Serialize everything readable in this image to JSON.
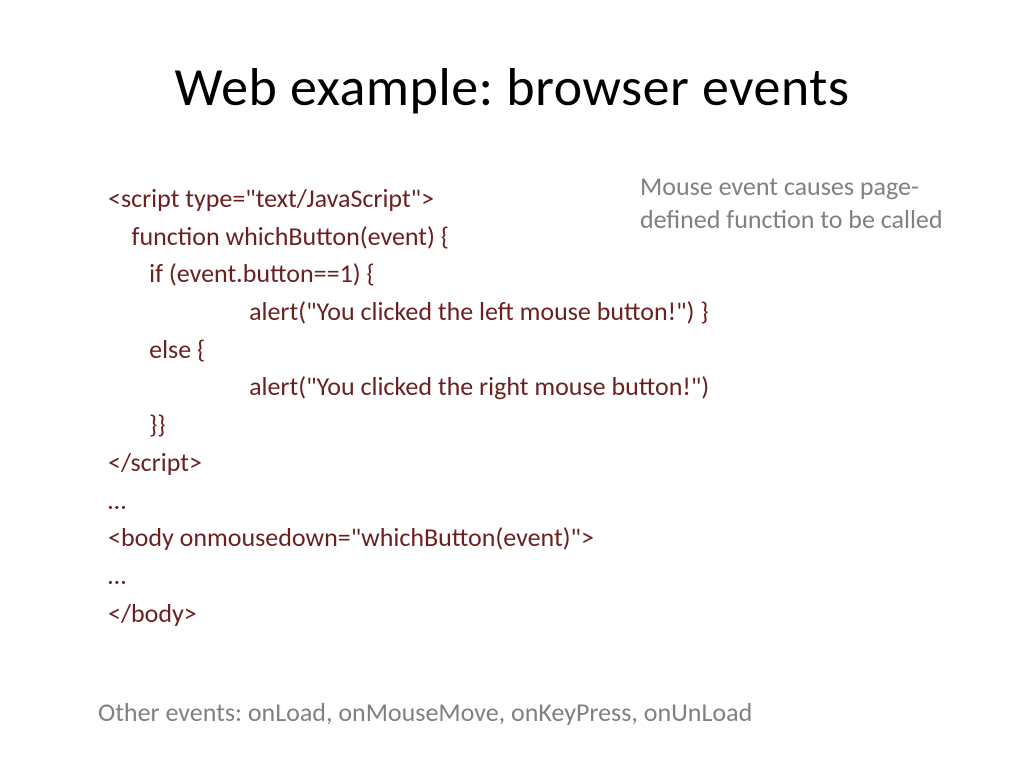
{
  "title": "Web example: browser events",
  "annotation": "Mouse event causes page-defined function to be called",
  "code": {
    "l1": "<script type=\"text/JavaScript\">",
    "l2": "    function whichButton(event) {",
    "l3": "       if (event.button==1) {",
    "l4": "                        alert(\"You clicked the left mouse button!\") }",
    "l5": "       else {",
    "l6": "                        alert(\"You clicked the right mouse button!\")",
    "l7": "       }}",
    "l8": "</script>",
    "l9": "…",
    "l10": "<body onmousedown=\"whichButton(event)\">",
    "l11": "…",
    "l12": "</body>"
  },
  "footer": "Other events: onLoad, onMouseMove, onKeyPress, onUnLoad"
}
